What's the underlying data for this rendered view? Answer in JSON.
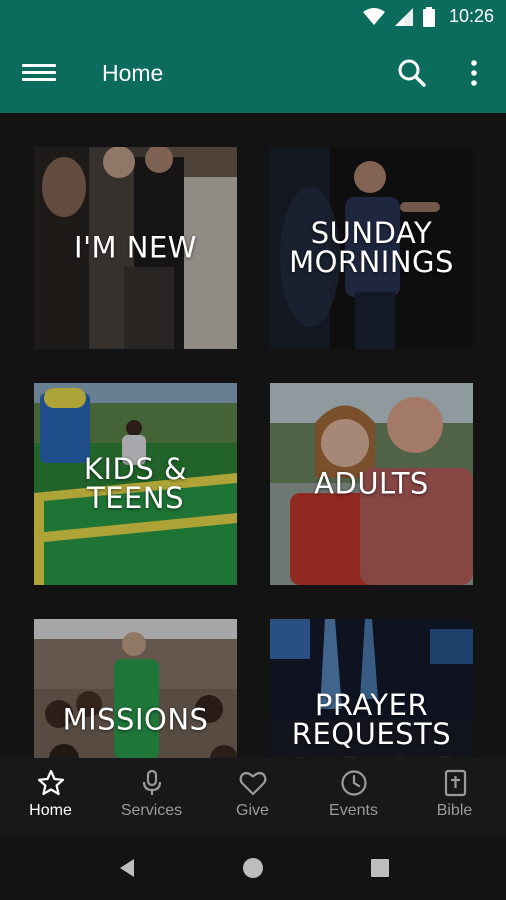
{
  "status": {
    "time": "10:26"
  },
  "appbar": {
    "title": "Home"
  },
  "tiles": [
    {
      "label": "I'M NEW"
    },
    {
      "label": "SUNDAY\nMORNINGS"
    },
    {
      "label": "KIDS & TEENS"
    },
    {
      "label": "ADULTS"
    },
    {
      "label": "MISSIONS"
    },
    {
      "label": "PRAYER\nREQUESTS"
    }
  ],
  "bottomnav": {
    "items": [
      {
        "label": "Home",
        "icon": "star-icon",
        "active": true
      },
      {
        "label": "Services",
        "icon": "microphone-icon"
      },
      {
        "label": "Give",
        "icon": "heart-icon"
      },
      {
        "label": "Events",
        "icon": "clock-icon"
      },
      {
        "label": "Bible",
        "icon": "bible-icon"
      }
    ]
  },
  "colors": {
    "appbar": "#0b6b5d",
    "background": "#131313",
    "nav_active": "#ffffff",
    "nav_inactive": "#9a9a9a"
  }
}
